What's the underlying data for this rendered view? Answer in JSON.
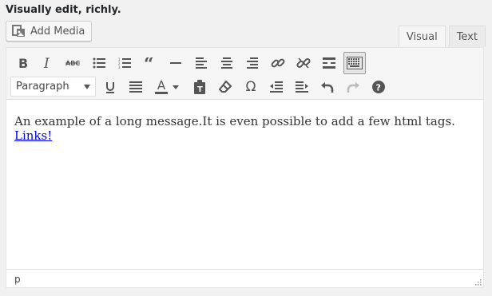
{
  "field": {
    "label": "Visually edit, richly."
  },
  "media": {
    "add_label": "Add Media"
  },
  "tabs": [
    {
      "label": "Visual",
      "active": true
    },
    {
      "label": "Text",
      "active": false
    }
  ],
  "toolbar": {
    "row1": [
      "bold-icon",
      "italic-icon",
      "strikethrough-icon",
      "bulleted-list-icon",
      "numbered-list-icon",
      "blockquote-icon",
      "horizontal-line-icon",
      "align-left-icon",
      "align-center-icon",
      "align-right-icon",
      "insert-link-icon",
      "remove-link-icon",
      "read-more-icon",
      "toolbar-toggle-icon"
    ],
    "row2": [
      "underline-icon",
      "justify-icon",
      "text-color-icon",
      "paste-as-text-icon",
      "clear-formatting-icon",
      "special-character-icon",
      "outdent-icon",
      "indent-icon",
      "undo-icon",
      "redo-icon",
      "help-icon"
    ],
    "format_select": {
      "value": "Paragraph"
    },
    "text_color_letter": "A"
  },
  "content": {
    "text": "An example of a long message.It is even possible to add a few html tags. ",
    "link": "Links!"
  },
  "statusbar": {
    "path": "p"
  },
  "colors": {
    "link": "#0000ee",
    "toolbar_bg": "#f5f5f5",
    "pressed_bg": "#e6e6e6"
  }
}
